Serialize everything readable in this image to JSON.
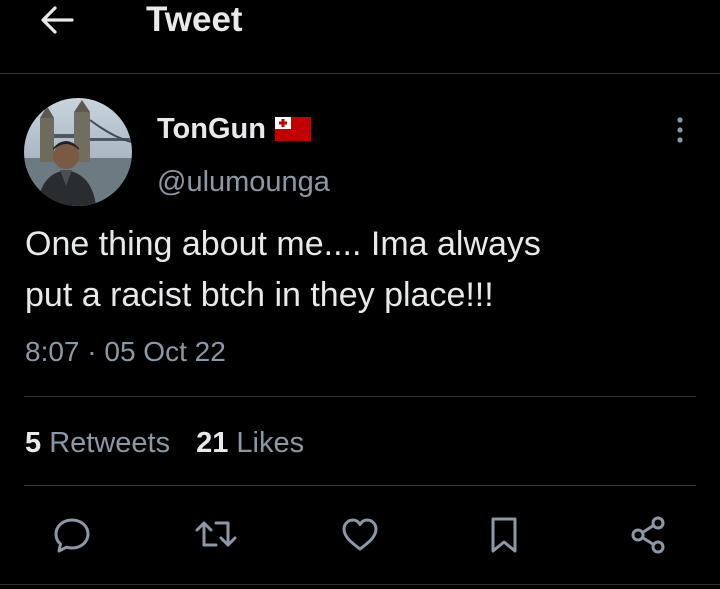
{
  "header": {
    "title": "Tweet",
    "back_icon": "arrow-left-icon"
  },
  "author": {
    "display_name": "TonGun",
    "flag": "tonga-flag",
    "handle": "@ulumounga",
    "avatar": "avatar"
  },
  "tweet": {
    "line1": "One thing about me.... Ima always",
    "line2": "put a racist btch in they place!!!",
    "timestamp": "8:07 · 05 Oct 22"
  },
  "stats": {
    "retweets_count": "5",
    "retweets_label": "Retweets",
    "likes_count": "21",
    "likes_label": "Likes"
  },
  "actions": {
    "reply_icon": "reply-icon",
    "retweet_icon": "retweet-icon",
    "like_icon": "heart-icon",
    "bookmark_icon": "bookmark-icon",
    "share_icon": "share-icon"
  },
  "colors": {
    "background": "#000000",
    "text": "#e7e9ea",
    "secondary": "#8b98a5",
    "divider": "#2f3336",
    "flag_red": "#c10000"
  }
}
